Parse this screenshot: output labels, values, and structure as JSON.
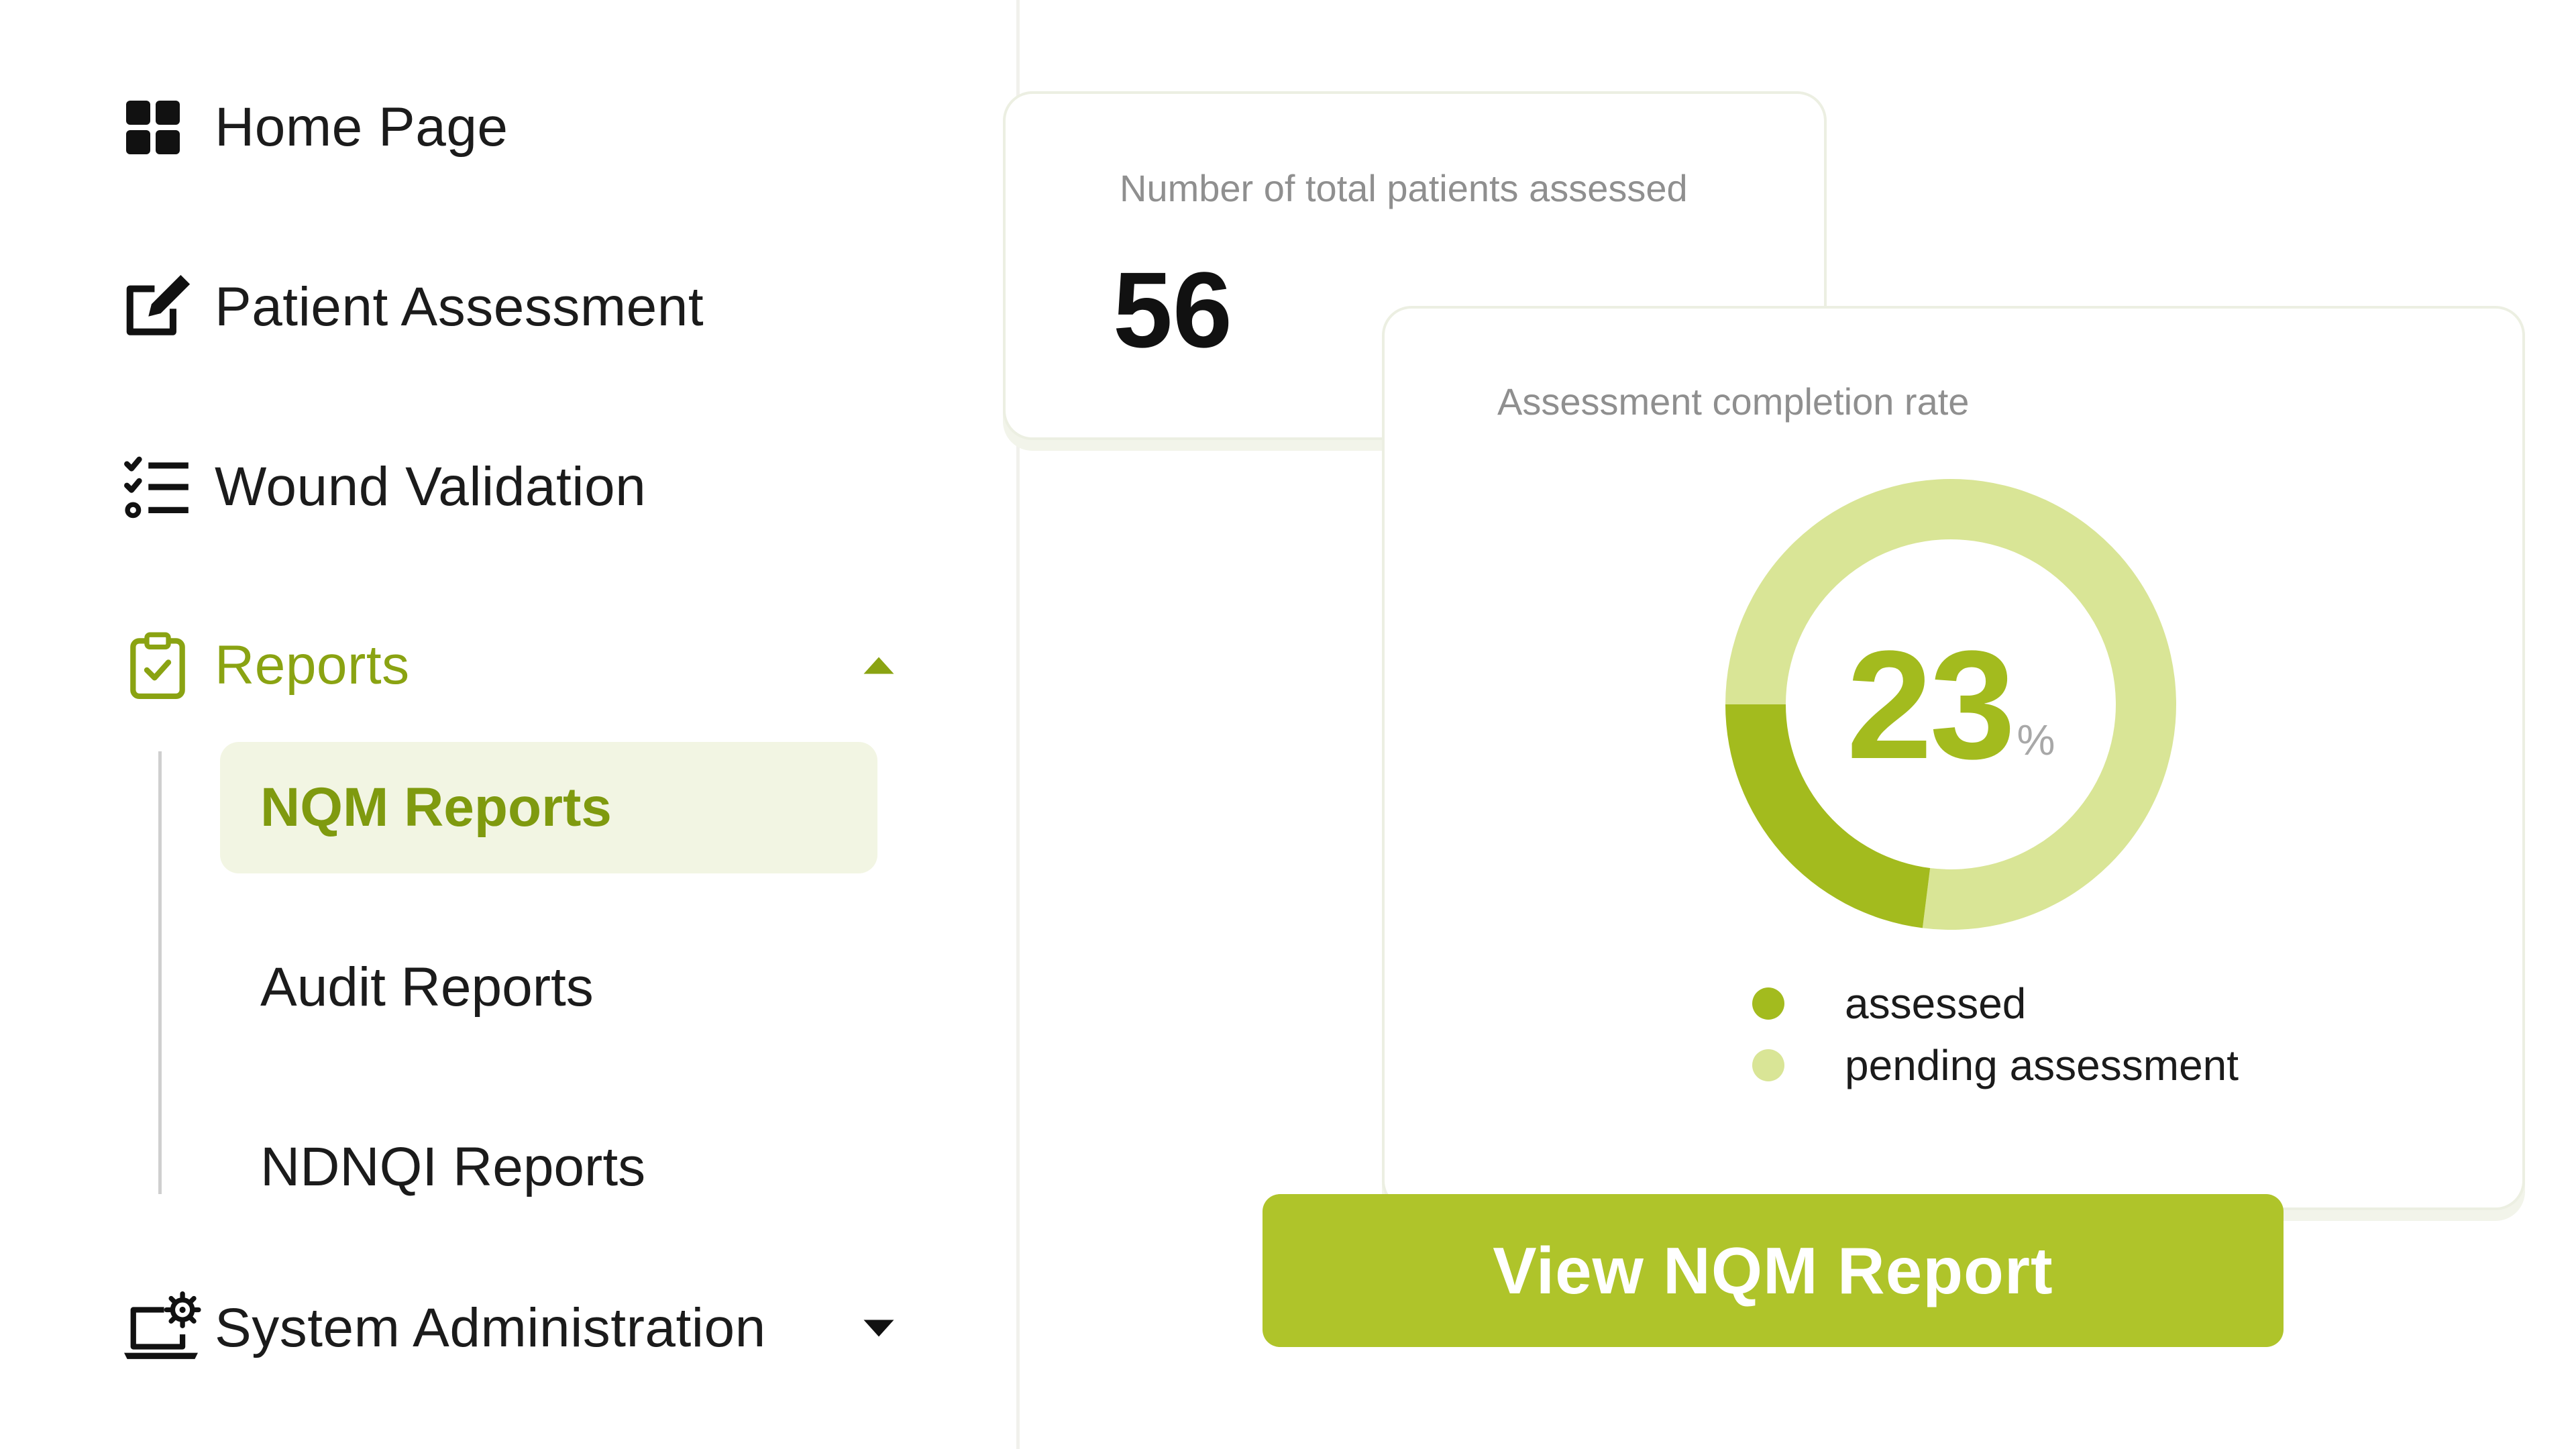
{
  "sidebar": {
    "items": [
      {
        "label": "Home Page",
        "icon": "grid-icon"
      },
      {
        "label": "Patient Assessment",
        "icon": "edit-note-icon"
      },
      {
        "label": "Wound Validation",
        "icon": "checklist-icon"
      },
      {
        "label": "Reports",
        "icon": "clipboard-check-icon",
        "expanded": true
      },
      {
        "label": "System Administration",
        "icon": "laptop-settings-icon",
        "expanded": false
      }
    ],
    "reports_subitems": [
      {
        "label": "NQM Reports",
        "selected": true
      },
      {
        "label": "Audit Reports",
        "selected": false
      },
      {
        "label": "NDNQI Reports",
        "selected": false
      }
    ]
  },
  "total_card": {
    "title": "Number of total patients assessed",
    "value": "56"
  },
  "rate_card": {
    "title": "Assessment completion rate",
    "percent_value": "23",
    "percent_sign": "%",
    "legend": [
      {
        "label": "assessed",
        "color": "#a3bb1e"
      },
      {
        "label": "pending assessment",
        "color": "#d9e596"
      }
    ]
  },
  "chart_data": {
    "type": "pie",
    "categories": [
      "assessed",
      "pending assessment"
    ],
    "values": [
      23,
      77
    ]
  },
  "cta": {
    "label": "View NQM Report"
  },
  "colors": {
    "accent": "#a3bb1e",
    "accent_light": "#d9e596",
    "button": "#afc42a",
    "selected_bg": "#f2f5e3",
    "active_text": "#8aa312"
  }
}
